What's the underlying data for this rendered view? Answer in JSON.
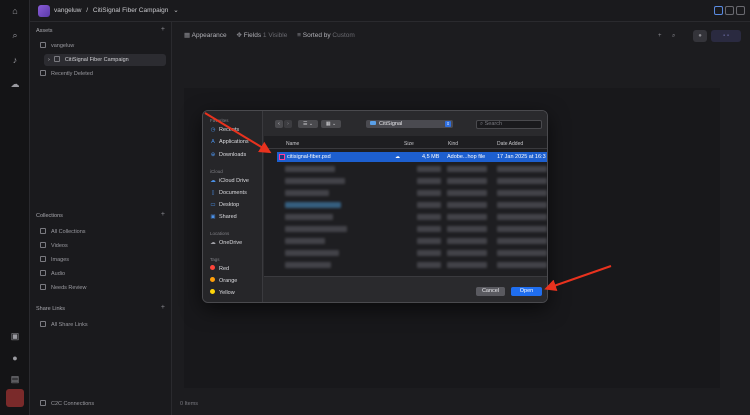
{
  "topbar": {
    "workspace": "vangeluw",
    "separator": "/",
    "project": "CitiSignal Fiber Campaign",
    "caret": "⌄"
  },
  "sidebar": {
    "assets_title": "Assets",
    "assets_items": [
      {
        "label": "vangeluw"
      },
      {
        "label": "CitiSignal Fiber Campaign"
      },
      {
        "label": "Recently Deleted"
      }
    ],
    "collections_title": "Collections",
    "collections_items": [
      {
        "label": "All Collections"
      },
      {
        "label": "Videos"
      },
      {
        "label": "Images"
      },
      {
        "label": "Audio"
      },
      {
        "label": "Needs Review"
      }
    ],
    "share_title": "Share Links",
    "share_items": [
      {
        "label": "All Share Links"
      }
    ],
    "bottom": "C2C Connections"
  },
  "toolbar": {
    "appearance": "Appearance",
    "fields": "Fields",
    "fields_sub": "1 Visible",
    "sorted": "Sorted by",
    "sorted_sub": "Custom"
  },
  "footer": {
    "items_count": "0 Items"
  },
  "dialog": {
    "favorites_title": "Favorites",
    "favorites": [
      {
        "label": "Recents",
        "icon": "clock-icon"
      },
      {
        "label": "Applications",
        "icon": "apps-icon"
      },
      {
        "label": "Downloads",
        "icon": "download-icon"
      }
    ],
    "icloud_title": "iCloud",
    "icloud": [
      {
        "label": "iCloud Drive"
      },
      {
        "label": "Documents"
      },
      {
        "label": "Desktop"
      },
      {
        "label": "Shared"
      }
    ],
    "locations_title": "Locations",
    "locations": [
      {
        "label": "OneDrive"
      }
    ],
    "tags_title": "Tags",
    "tags": [
      {
        "label": "Red",
        "color": "#ff453a"
      },
      {
        "label": "Orange",
        "color": "#ff9f0a"
      },
      {
        "label": "Yellow",
        "color": "#ffd60a"
      }
    ],
    "location": "CitiSignal",
    "search_placeholder": "Search",
    "columns": {
      "name": "Name",
      "size": "Size",
      "kind": "Kind",
      "date": "Date Added"
    },
    "selected_file": {
      "name": "citisignal-fiber.psd",
      "size": "4,5 MB",
      "kind": "Adobe...hop file",
      "date": "17 Jan 2025 at 16:3"
    },
    "cancel": "Cancel",
    "open": "Open"
  },
  "colors": {
    "accent": "#1f6ef0",
    "annotation": "#e8321e"
  }
}
